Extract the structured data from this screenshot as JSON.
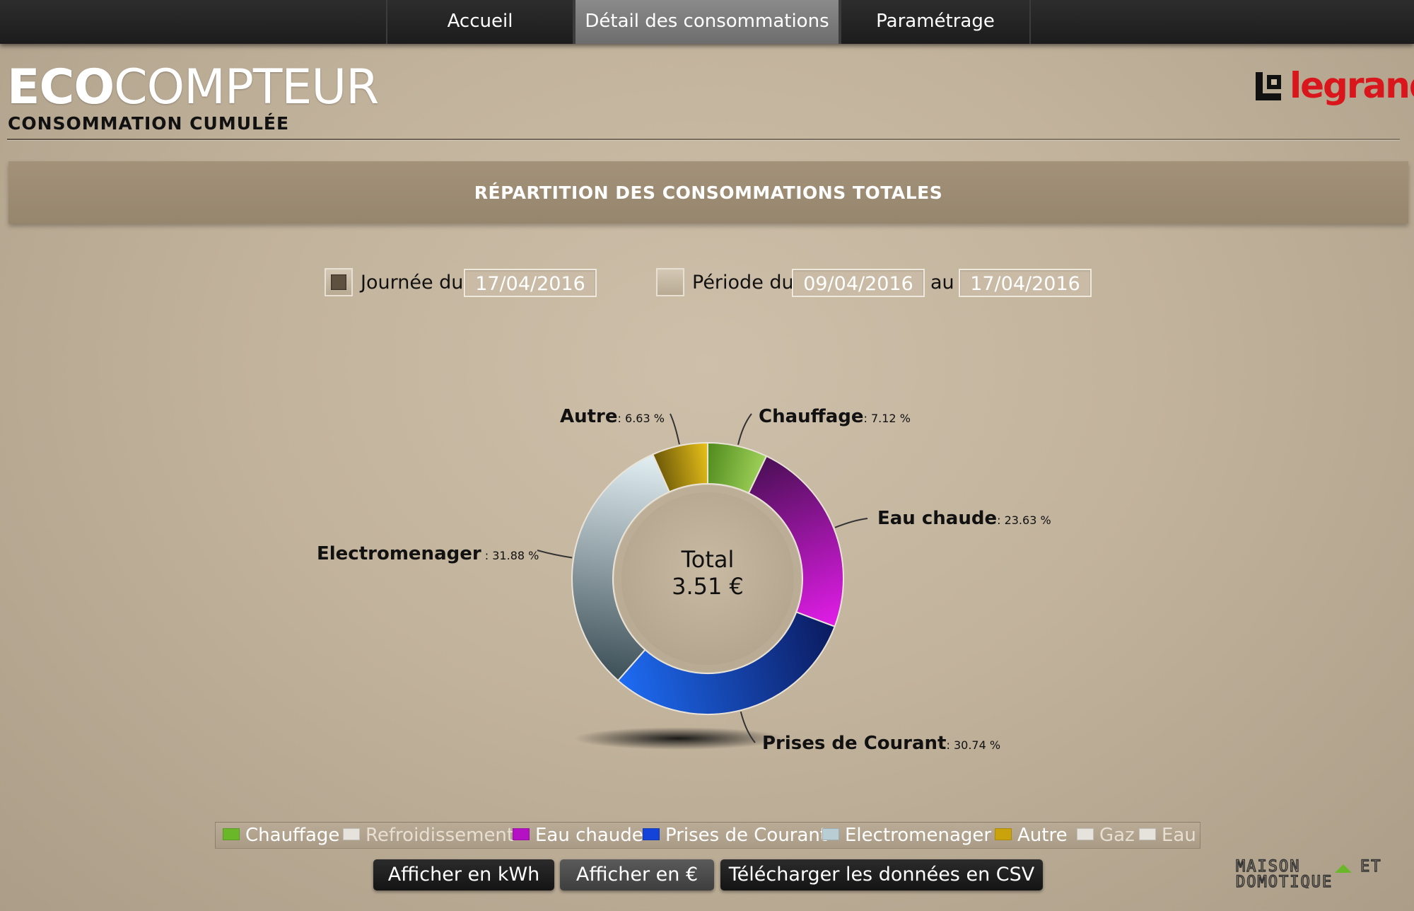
{
  "nav": {
    "tabs": [
      {
        "label": "Accueil",
        "active": false
      },
      {
        "label": "Détail des consommations",
        "active": true
      },
      {
        "label": "Paramétrage",
        "active": false
      }
    ]
  },
  "header": {
    "brand_bold": "ECO",
    "brand_rest": "COMPTEUR",
    "subtitle": "CONSOMMATION CUMULÉE",
    "logo_text": "legrand"
  },
  "section": {
    "title": "RÉPARTITION DES CONSOMMATIONS TOTALES"
  },
  "filters": {
    "day": {
      "label": "Journée du",
      "date": "17/04/2016",
      "checked": true
    },
    "period": {
      "label": "Période du",
      "from": "09/04/2016",
      "to_label": "au",
      "to": "17/04/2016",
      "checked": false
    }
  },
  "chart_data": {
    "type": "pie",
    "center_label": "Total",
    "center_value": "3.51 €",
    "unit": "%",
    "slices": [
      {
        "name": "Chauffage",
        "value": 7.12,
        "label": "7.12 %",
        "color_light": "#9fd15a",
        "color_dark": "#4f8a1c"
      },
      {
        "name": "Eau chaude",
        "value": 23.63,
        "label": "23.63 %",
        "color_light": "#e21de8",
        "color_dark": "#4a0f55"
      },
      {
        "name": "Prises de Courant",
        "value": 30.74,
        "label": "30.74 %",
        "color_light": "#1e6cf4",
        "color_dark": "#0b1a5e"
      },
      {
        "name": "Electromenager",
        "value": 31.88,
        "label": ": 31.88 %",
        "color_light": "#e3f0f4",
        "color_dark": "#3c4e56"
      },
      {
        "name": "Autre",
        "value": 6.63,
        "label": "6.63 %",
        "color_light": "#e9c21a",
        "color_dark": "#6b5708"
      }
    ]
  },
  "legend": [
    {
      "name": "Chauffage",
      "color": "#6ab82a",
      "active": true
    },
    {
      "name": "Refroidissement",
      "color": "#e6e2dc",
      "active": false
    },
    {
      "name": "Eau chaude",
      "color": "#b411c4",
      "active": true
    },
    {
      "name": "Prises de Courant",
      "color": "#1343d8",
      "active": true
    },
    {
      "name": "Electromenager",
      "color": "#b9cdd4",
      "active": true
    },
    {
      "name": "Autre",
      "color": "#c9a20c",
      "active": true
    },
    {
      "name": "Gaz",
      "color": "#e6e2dc",
      "active": false
    },
    {
      "name": "Eau",
      "color": "#e6e2dc",
      "active": false
    }
  ],
  "buttons": {
    "kwh": "Afficher en kWh",
    "euro": "Afficher en €",
    "csv": "Télécharger les données en CSV"
  },
  "watermark": {
    "line1": "MAISON",
    "line1b": "ET",
    "line2": "DOMOTIQUE"
  }
}
